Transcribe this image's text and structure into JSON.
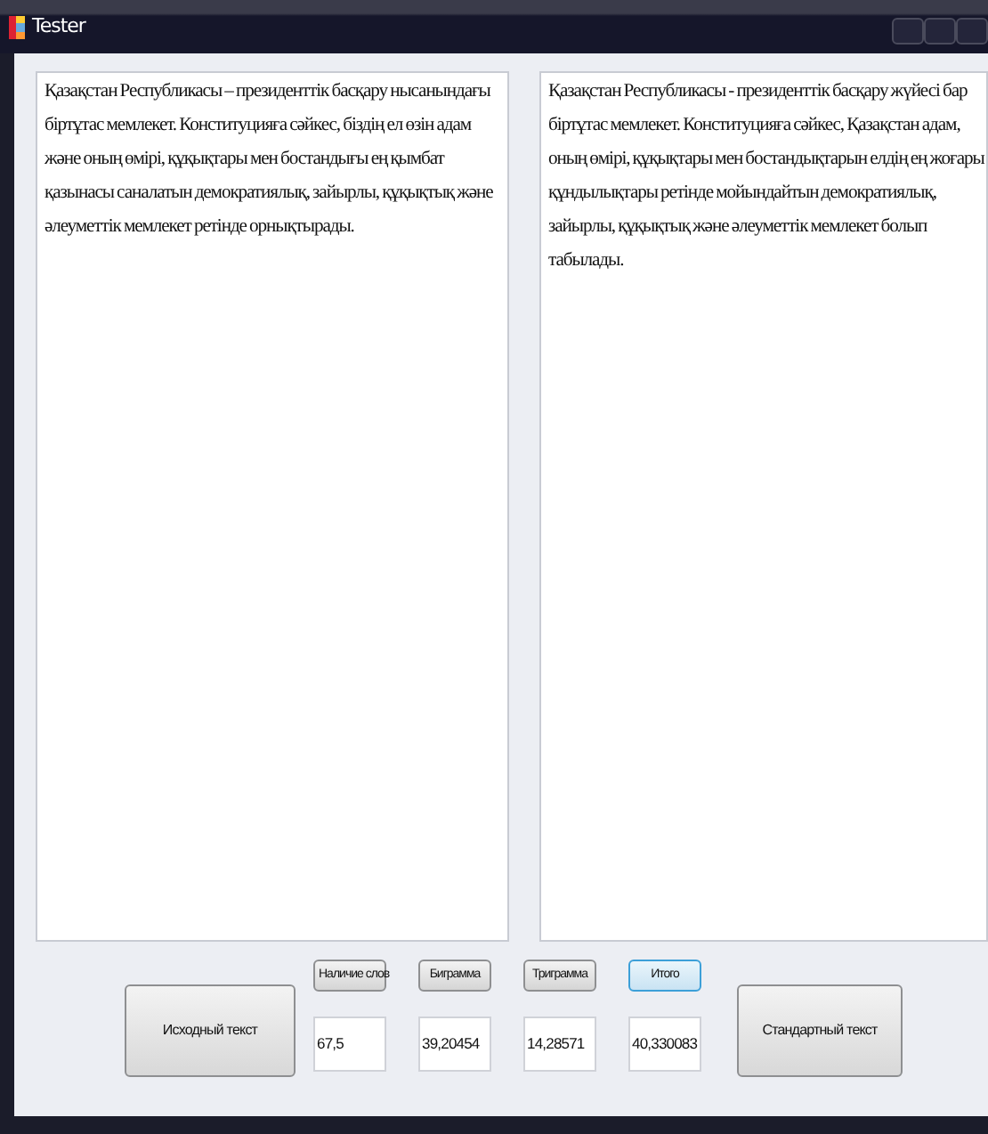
{
  "window": {
    "title": "Tester"
  },
  "source_text": "Қазақстан Республикасы – президенттік басқару нысанындағы біртұтас мемлекет. Конституцияға сәйкес, біздің ел өзін адам және оның өмірі, құқықтары мен бостандығы ең қымбат қазынасы саналатын демократиялық, зайырлы, құқықтық және әлеуметтік мемлекет ретінде орнықтырады.",
  "standard_text": "Қазақстан Республикасы - президенттік басқару жүйесі бар біртұтас мемлекет. Конституцияға сәйкес, Қазақстан адам, оның өмірі, құқықтары мен бостандықтарын елдің ең жоғары құндылықтары ретінде мойындайтын демократиялық, зайырлы, құқықтық және әлеуметтік мемлекет болып табылады.",
  "source_button": "Исходный текст",
  "metrics": [
    {
      "button": "Наличие слов",
      "focused": false,
      "value": "67,5"
    },
    {
      "button": "Биграмма",
      "focused": false,
      "value": "39,20454"
    },
    {
      "button": "Триграмма",
      "focused": false,
      "value": "14,28571"
    },
    {
      "button": "Итого",
      "focused": true,
      "value": "40,330083"
    }
  ],
  "standard_button": "Стандартный текст"
}
